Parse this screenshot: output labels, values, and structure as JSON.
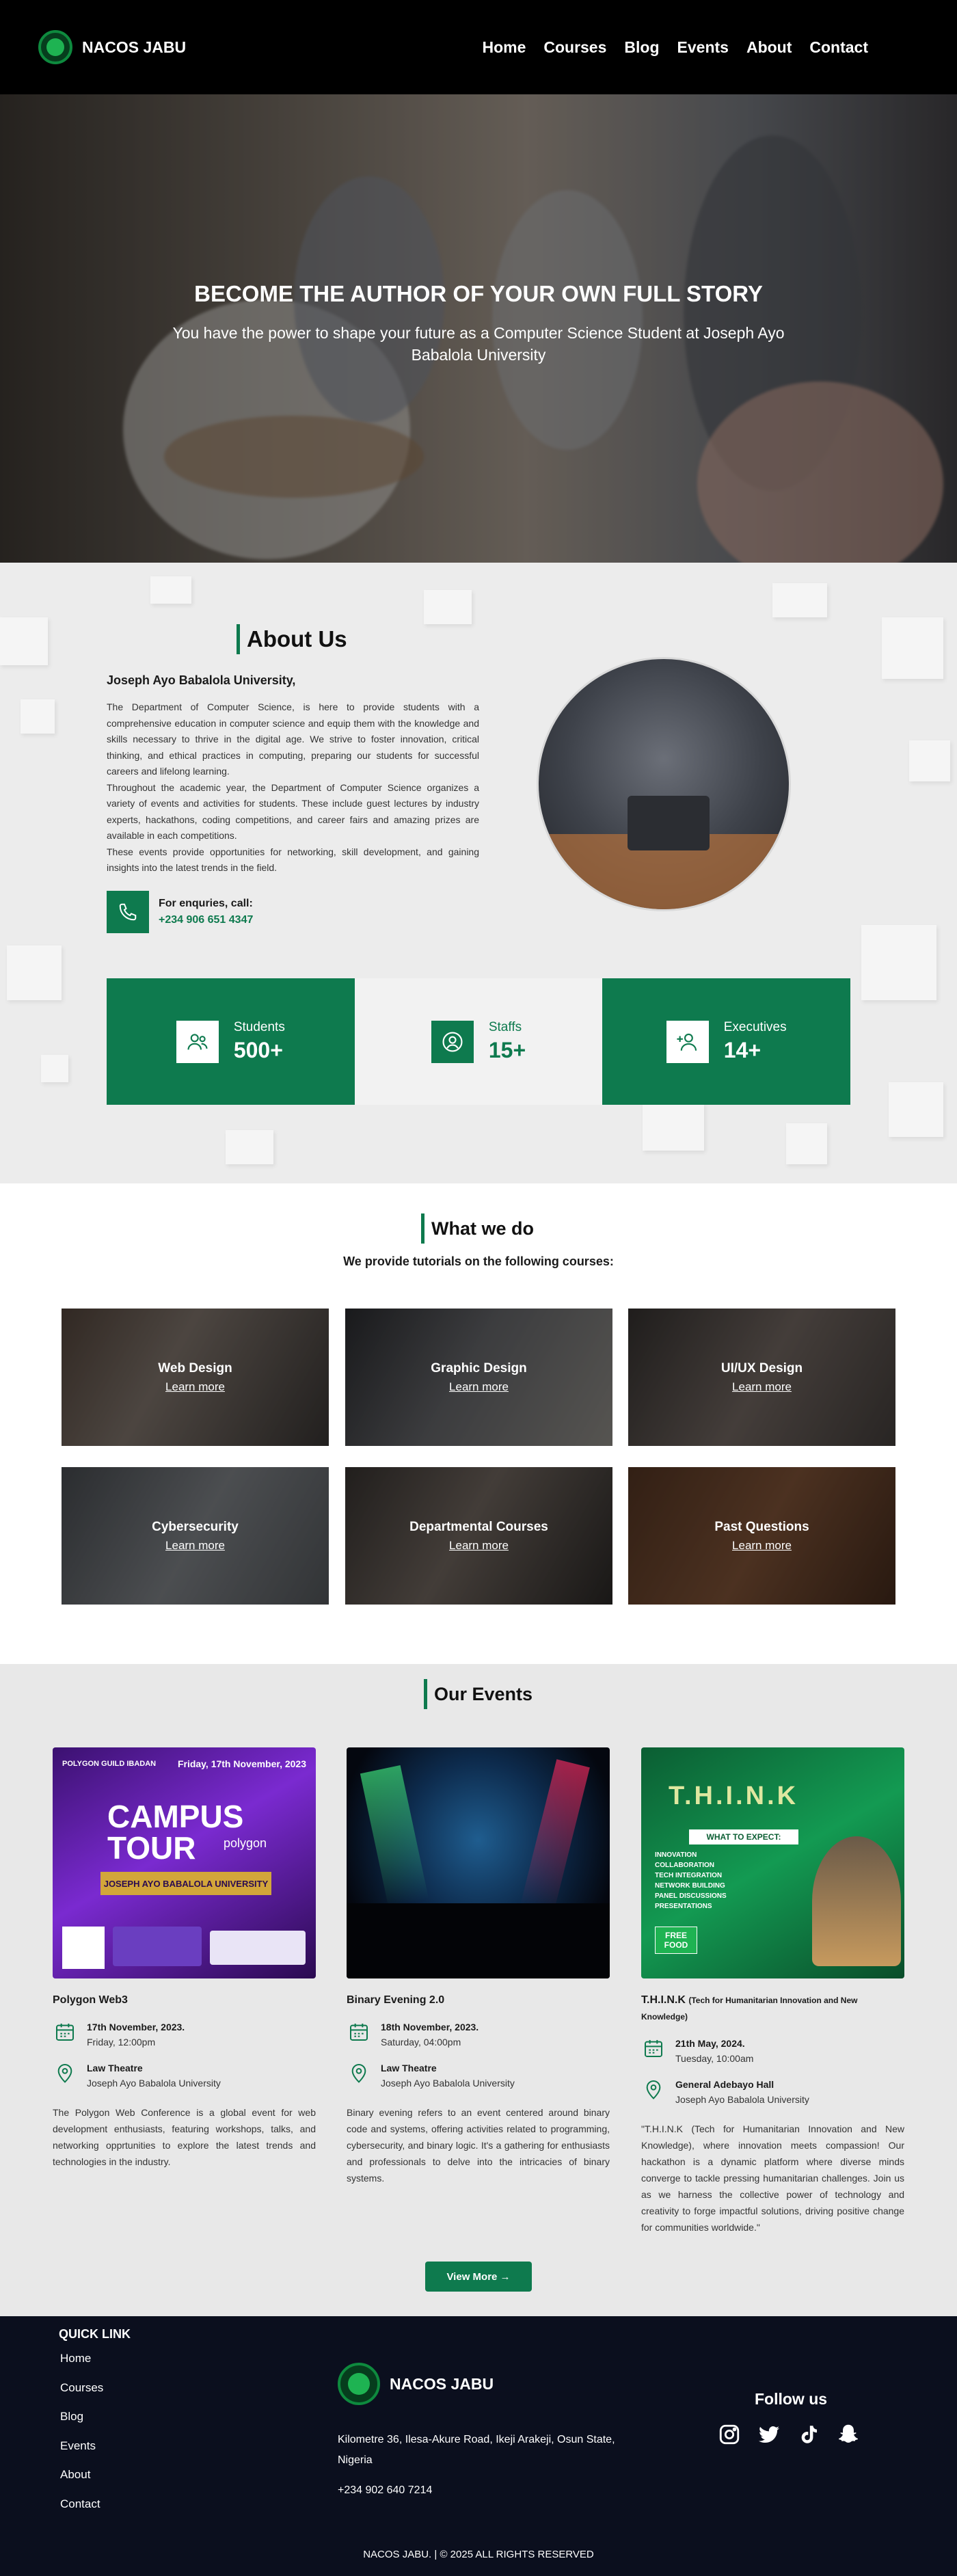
{
  "nav": {
    "brand": "NACOS JABU",
    "links": [
      "Home",
      "Courses",
      "Blog",
      "Events",
      "About",
      "Contact"
    ]
  },
  "hero": {
    "title": "BECOME THE AUTHOR OF YOUR OWN FULL STORY",
    "subtitle": "You have the power to shape your future as a Computer Science Student at Joseph Ayo Babalola University"
  },
  "about": {
    "heading": "About Us",
    "org": "Joseph Ayo Babalola University,",
    "paragraphs": [
      "The Department of Computer Science, is here to provide students with a comprehensive education in computer science and equip them with the knowledge and skills necessary to thrive in the digital age. We strive to foster innovation, critical thinking, and ethical practices in computing, preparing our students for successful careers and lifelong learning.",
      "Throughout the academic year, the Department of Computer Science organizes a variety of events and activities for students. These include guest lectures by industry experts, hackathons, coding competitions, and career fairs and amazing prizes are available in each competitions.",
      "These events provide opportunities for networking, skill development, and gaining insights into the latest trends in the field."
    ],
    "contact_label": "For enquries, call:",
    "contact_number": "+234 906 651 4347"
  },
  "stats": [
    {
      "name": "Students",
      "value": "500+"
    },
    {
      "name": "Staffs",
      "value": "15+"
    },
    {
      "name": "Executives",
      "value": "14+"
    }
  ],
  "services": {
    "heading": "What we do",
    "subtitle": "We provide tutorials on the following courses:",
    "link_label": "Learn more",
    "cards": [
      {
        "title": "Web Design"
      },
      {
        "title": "Graphic Design"
      },
      {
        "title": "UI/UX Design"
      },
      {
        "title": "Cybersecurity"
      },
      {
        "title": "Departmental Courses"
      },
      {
        "title": "Past Questions"
      }
    ]
  },
  "events": {
    "heading": "Our Events",
    "items": [
      {
        "title": "Polygon Web3",
        "title_small": "",
        "date": "17th November, 2023.",
        "time": "Friday, 12:00pm",
        "venue": "Law Theatre",
        "venue_sub": "Joseph Ayo Babalola University",
        "desc": "The Polygon Web Conference is a global event for web development enthusiasts, featuring workshops, talks, and networking opprtunities to explore the latest trends and technologies in the industry.",
        "poster_lines": [
          "Friday, 17th November, 2023",
          "CAMPUS TOUR",
          "polygon",
          "JOSEPH AYO BABALOLA UNIVERSITY"
        ]
      },
      {
        "title": "Binary Evening 2.0",
        "title_small": "",
        "date": "18th November, 2023.",
        "time": "Saturday, 04:00pm",
        "venue": "Law Theatre",
        "venue_sub": "Joseph Ayo Babalola University",
        "desc": "Binary evening refers to an event centered around binary code and systems, offering activities related to programming, cybersecurity, and binary logic. It's a gathering for enthusiasts and professionals to delve into the intricacies of binary systems.",
        "poster_lines": []
      },
      {
        "title": "T.H.I.N.K",
        "title_small": "(Tech for Humanitarian Innovation and New Knowledge)",
        "date": "21th May, 2024.",
        "time": "Tuesday, 10:00am",
        "venue": "General Adebayo Hall",
        "venue_sub": "Joseph Ayo Babalola University",
        "desc": "\"T.H.I.N.K (Tech for Humanitarian Innovation and New Knowledge), where innovation meets compassion! Our hackathon is a dynamic platform where diverse minds converge to tackle pressing humanitarian challenges. Join us as we harness the collective power of technology and creativity to forge impactful solutions, driving positive change for communities worldwide.\"",
        "poster_lines": [
          "T.H.I.N.K",
          "WHAT TO EXPECT:",
          "INNOVATION",
          "COLLABORATION",
          "TECH INTEGRATION",
          "NETWORK BUILDING",
          "PANEL DISCUSSIONS",
          "PRESENTATIONS",
          "FREE FOOD"
        ]
      }
    ],
    "view_more": "View More →"
  },
  "footer": {
    "quick_link_title": "QUICK LINK",
    "links": [
      "Home",
      "Courses",
      "Blog",
      "Events",
      "About",
      "Contact"
    ],
    "brand": "NACOS JABU",
    "address": "Kilometre 36, Ilesa-Akure Road, Ikeji Arakeji, Osun State, Nigeria",
    "phone": "+234 902 640 7214",
    "follow_title": "Follow us",
    "socials": [
      "instagram-icon",
      "twitter-icon",
      "tiktok-icon",
      "snapchat-icon"
    ],
    "copyright": "NACOS JABU. | © 2025 ALL RIGHTS RESERVED"
  },
  "colors": {
    "accent": "#0e7a4e",
    "nav_bg": "#000000",
    "footer_bg": "#0b0f1e"
  }
}
